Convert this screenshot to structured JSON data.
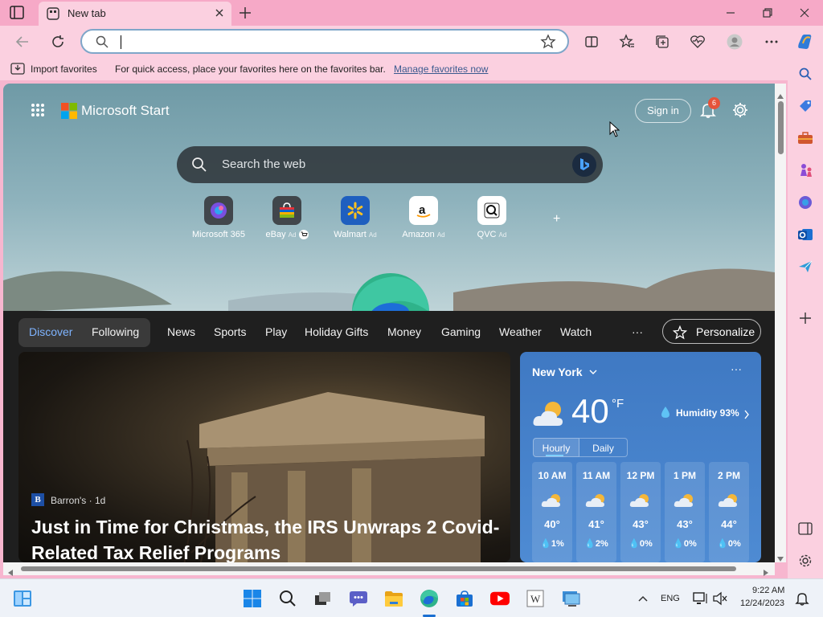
{
  "tab": {
    "title": "New tab"
  },
  "address": {
    "value": ""
  },
  "favorites_bar": {
    "import": "Import favorites",
    "hint": "For quick access, place your favorites here on the favorites bar.",
    "manage": "Manage favorites now"
  },
  "page": {
    "brand": "Microsoft Start",
    "sign_in": "Sign in",
    "notifications": "6",
    "search_placeholder": "Search the web",
    "quick_links": [
      {
        "label": "Microsoft 365",
        "ad": ""
      },
      {
        "label": "eBay",
        "ad": "Ad"
      },
      {
        "label": "Walmart",
        "ad": "Ad"
      },
      {
        "label": "Amazon",
        "ad": "Ad"
      },
      {
        "label": "QVC",
        "ad": "Ad"
      }
    ],
    "add_tile": "+"
  },
  "feed_nav": {
    "discover": "Discover",
    "following": "Following",
    "items": [
      "News",
      "Sports",
      "Play",
      "Holiday Gifts",
      "Money",
      "Gaming",
      "Weather",
      "Watch"
    ],
    "more": "···",
    "personalize": "Personalize"
  },
  "hero": {
    "source_logo": "B",
    "source": "Barron's · 1d",
    "headline": "Just in Time for Christmas, the IRS Unwraps 2 Covid-Related Tax Relief Programs"
  },
  "weather": {
    "city": "New York",
    "more": "···",
    "temp": "40",
    "unit": "°F",
    "humidity": "Humidity 93%",
    "tab_hourly": "Hourly",
    "tab_daily": "Daily",
    "hours": [
      {
        "time": "10 AM",
        "temp": "40°",
        "precip": "1%"
      },
      {
        "time": "11 AM",
        "temp": "41°",
        "precip": "2%"
      },
      {
        "time": "12 PM",
        "temp": "43°",
        "precip": "0%"
      },
      {
        "time": "1 PM",
        "temp": "43°",
        "precip": "0%"
      },
      {
        "time": "2 PM",
        "temp": "44°",
        "precip": "0%"
      }
    ]
  },
  "taskbar": {
    "lang": "ENG",
    "time": "9:22 AM",
    "date": "12/24/2023"
  },
  "colors": {
    "frame": "#f6a9c7",
    "toolbar": "#fbd0e0",
    "weather_card": "#4e8bd3",
    "accent": "#7fb4ff"
  }
}
